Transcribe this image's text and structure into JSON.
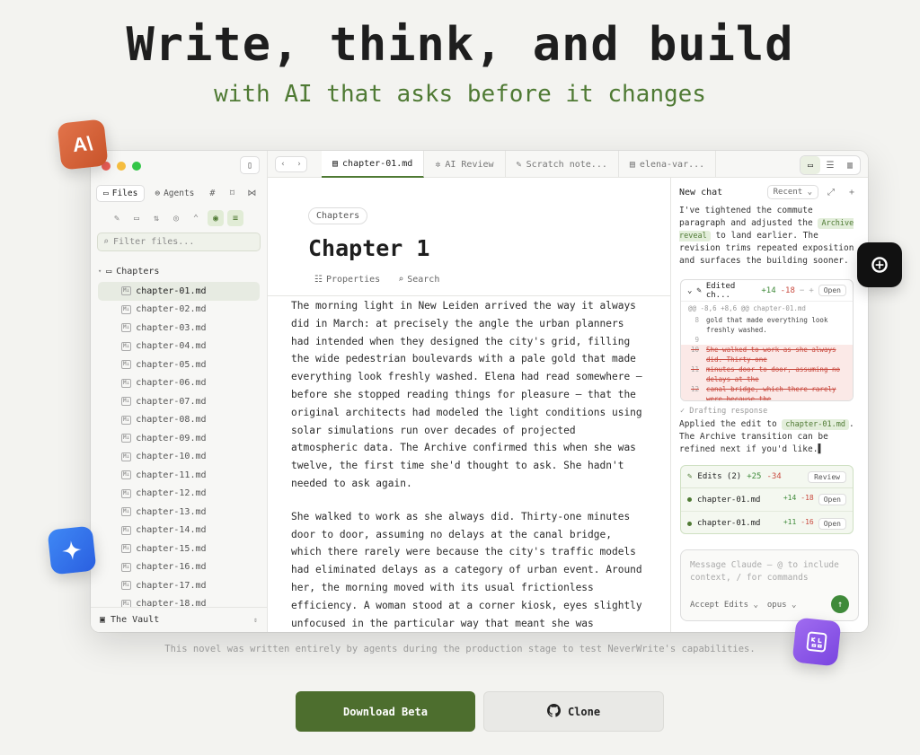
{
  "hero": {
    "title": "Write, think, and build",
    "subtitle": "with AI that asks before it changes"
  },
  "colors": {
    "accent": "#4f7a34",
    "button_primary": "#4d6e2e",
    "background": "#f3f3f0"
  },
  "floating_icons": [
    "anthropic-icon",
    "openai-icon",
    "gemini-icon",
    "kilo-icon"
  ],
  "sidebar": {
    "tabs": {
      "files": "Files",
      "agents": "Agents"
    },
    "filter_placeholder": "Filter files...",
    "folder": "Chapters",
    "files": [
      "chapter-01.md",
      "chapter-02.md",
      "chapter-03.md",
      "chapter-04.md",
      "chapter-05.md",
      "chapter-06.md",
      "chapter-07.md",
      "chapter-08.md",
      "chapter-09.md",
      "chapter-10.md",
      "chapter-11.md",
      "chapter-12.md",
      "chapter-13.md",
      "chapter-14.md",
      "chapter-15.md",
      "chapter-16.md",
      "chapter-17.md",
      "chapter-18.md"
    ],
    "md_badge": "M↓",
    "vault": "The Vault"
  },
  "tabs": [
    "chapter-01.md",
    "AI Review",
    "Scratch note...",
    "elena-var..."
  ],
  "editor": {
    "breadcrumb": "Chapters",
    "title": "Chapter 1",
    "properties": "Properties",
    "search": "Search",
    "paragraphs": [
      "The morning light in New Leiden arrived the way it always did in March: at precisely the angle the urban planners had intended when they designed the city's grid, filling the wide pedestrian boulevards with a pale gold that made everything look freshly washed. Elena had read somewhere — before she stopped reading things for pleasure — that the original architects had modeled the light conditions using solar simulations run over decades of projected atmospheric data. The Archive confirmed this when she was twelve, the first time she'd thought to ask. She hadn't needed to ask again.",
      "She walked to work as she always did. Thirty-one minutes door to door, assuming no delays at the canal bridge, which there rarely were because the city's traffic models had eliminated delays as a category of urban event. Around her, the morning moved with its usual frictionless efficiency. A woman stood at a corner kiosk, eyes slightly unfocused in the particular way that meant she was querying The Archive"
    ]
  },
  "chat": {
    "title": "New chat",
    "recent": "Recent",
    "intro_before": "I've tightened the commute paragraph and adjusted the",
    "intro_pill": "Archive reveal",
    "intro_after": "to land earlier. The revision trims repeated exposition and surfaces the building sooner.",
    "diff": {
      "label": "Edited ch...",
      "added": "+14",
      "removed": "-18",
      "open": "Open",
      "hunk": "@@ -8,6 +8,6 @@ chapter-01.md",
      "lines": [
        {
          "n": "8",
          "text": "gold that made everything look",
          "del": false
        },
        {
          "n": "",
          "text": "freshly washed.",
          "del": false
        },
        {
          "n": "9",
          "text": "",
          "del": false
        },
        {
          "n": "10",
          "text": "She walked to work as she always did. Thirty-one",
          "del": true
        },
        {
          "n": "11",
          "text": "minutes door to door, assuming no delays at the",
          "del": true
        },
        {
          "n": "12",
          "text": "canal bridge, which there rarely were because the",
          "del": true
        }
      ]
    },
    "drafting": "Drafting response",
    "applied_before": "Applied the edit to",
    "applied_pill": "chapter-01.md",
    "applied_after": ". The Archive transition can be refined next if you'd like.",
    "edits": {
      "label": "Edits (2)",
      "added": "+25",
      "removed": "-34",
      "review": "Review",
      "rows": [
        {
          "file": "chapter-01.md",
          "added": "+14",
          "removed": "-18",
          "open": "Open"
        },
        {
          "file": "chapter-01.md",
          "added": "+11",
          "removed": "-16",
          "open": "Open"
        }
      ]
    },
    "composer_placeholder": "Message Claude — @ to include context, / for commands",
    "accept_edits": "Accept Edits",
    "model": "opus"
  },
  "caption": "This novel was written entirely by agents during the production stage to test NeverWrite's capabilities.",
  "cta": {
    "download": "Download Beta",
    "clone": "Clone"
  }
}
